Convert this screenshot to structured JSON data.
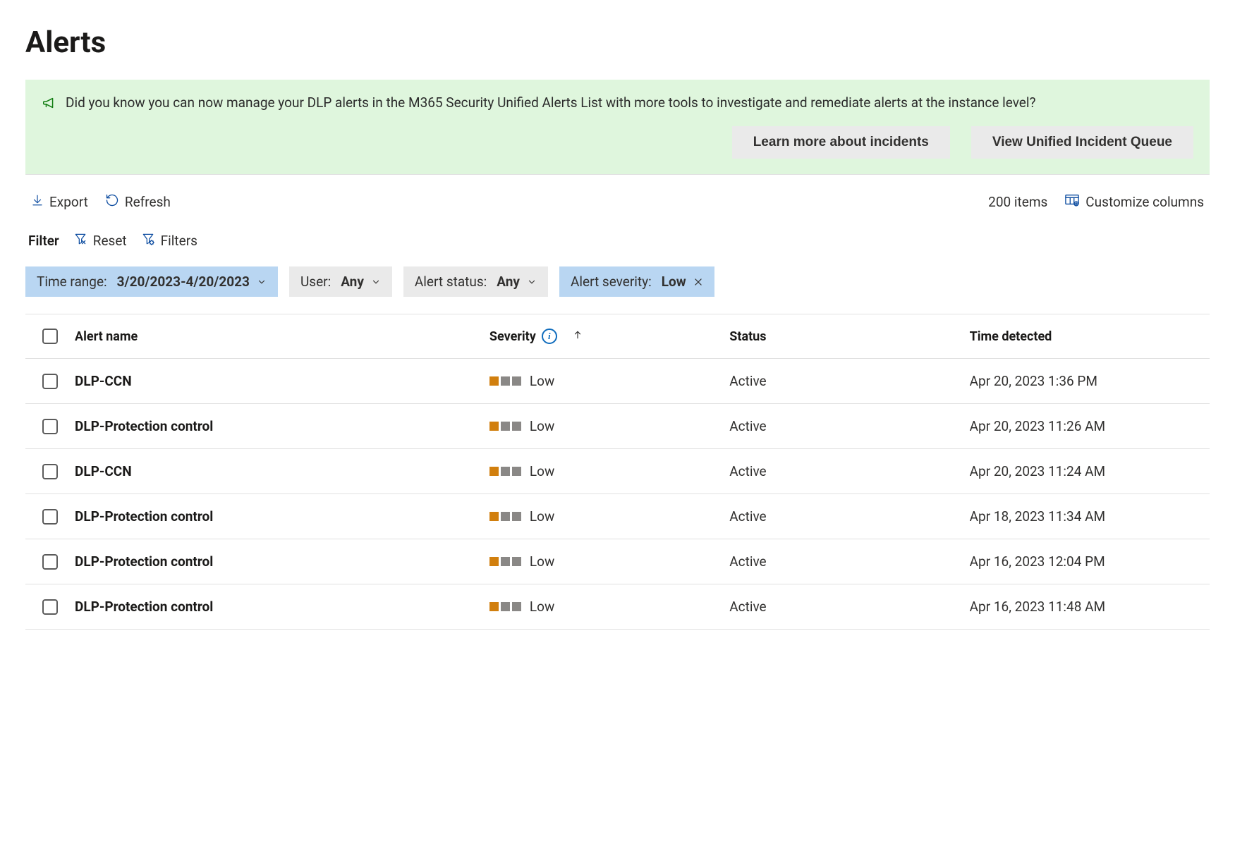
{
  "page": {
    "title": "Alerts"
  },
  "banner": {
    "text": "Did you know you can now manage your DLP alerts in the M365 Security Unified Alerts List with more tools to investigate and remediate alerts at the instance level?",
    "learn_more": "Learn more about incidents",
    "view_queue": "View Unified Incident Queue"
  },
  "toolbar": {
    "export": "Export",
    "refresh": "Refresh",
    "item_count": "200 items",
    "customize": "Customize columns"
  },
  "filterbar": {
    "filter_label": "Filter",
    "reset": "Reset",
    "filters": "Filters"
  },
  "chips": {
    "time_range": {
      "label": "Time range:",
      "value": "3/20/2023-4/20/2023"
    },
    "user": {
      "label": "User:",
      "value": "Any"
    },
    "alert_status": {
      "label": "Alert status:",
      "value": "Any"
    },
    "alert_severity": {
      "label": "Alert severity:",
      "value": "Low"
    }
  },
  "columns": {
    "alert_name": "Alert name",
    "severity": "Severity",
    "status": "Status",
    "time_detected": "Time detected"
  },
  "rows": [
    {
      "name": "DLP-CCN",
      "severity": "Low",
      "status": "Active",
      "time": "Apr 20, 2023 1:36 PM"
    },
    {
      "name": "DLP-Protection control",
      "severity": "Low",
      "status": "Active",
      "time": "Apr 20, 2023 11:26 AM"
    },
    {
      "name": "DLP-CCN",
      "severity": "Low",
      "status": "Active",
      "time": "Apr 20, 2023 11:24 AM"
    },
    {
      "name": "DLP-Protection control",
      "severity": "Low",
      "status": "Active",
      "time": "Apr 18, 2023 11:34 AM"
    },
    {
      "name": "DLP-Protection control",
      "severity": "Low",
      "status": "Active",
      "time": "Apr 16, 2023 12:04 PM"
    },
    {
      "name": "DLP-Protection control",
      "severity": "Low",
      "status": "Active",
      "time": "Apr 16, 2023 11:48 AM"
    }
  ]
}
